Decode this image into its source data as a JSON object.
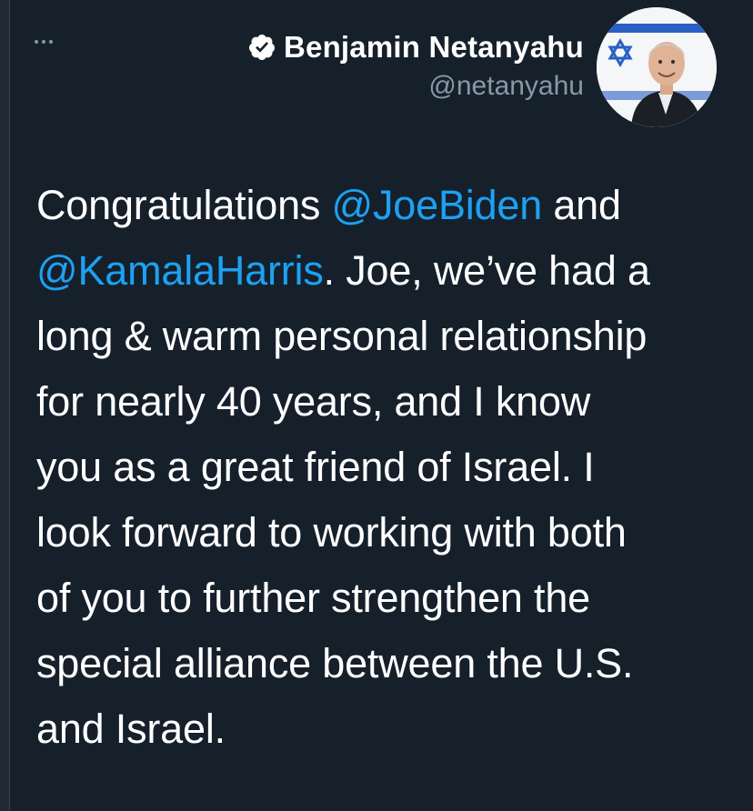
{
  "author": {
    "display_name": "Benjamin Netanyahu",
    "handle": "@netanyahu",
    "verified": true,
    "avatar_icon": "profile-photo-with-israeli-flag"
  },
  "menu": {
    "more_icon": "more-horizontal-icon"
  },
  "tweet": {
    "lines": [
      [
        {
          "type": "text",
          "text": "Congratulations "
        },
        {
          "type": "mention",
          "text": "@JoeBiden"
        },
        {
          "type": "text",
          "text": " and"
        }
      ],
      [
        {
          "type": "mention",
          "text": "@KamalaHarris"
        },
        {
          "type": "text",
          "text": ". Joe, we’ve had a"
        }
      ],
      [
        {
          "type": "text",
          "text": "long & warm personal relationship"
        }
      ],
      [
        {
          "type": "text",
          "text": "for nearly 40 years, and I know"
        }
      ],
      [
        {
          "type": "text",
          "text": "you as a great friend of Israel. I"
        }
      ],
      [
        {
          "type": "text",
          "text": "look forward to working with both"
        }
      ],
      [
        {
          "type": "text",
          "text": "of you to further strengthen the"
        }
      ],
      [
        {
          "type": "text",
          "text": "special alliance between the U.S."
        }
      ],
      [
        {
          "type": "text",
          "text": "and Israel."
        }
      ]
    ]
  },
  "colors": {
    "background": "#15202b",
    "mention": "#1da1f2",
    "secondary_text": "#8899a6"
  }
}
